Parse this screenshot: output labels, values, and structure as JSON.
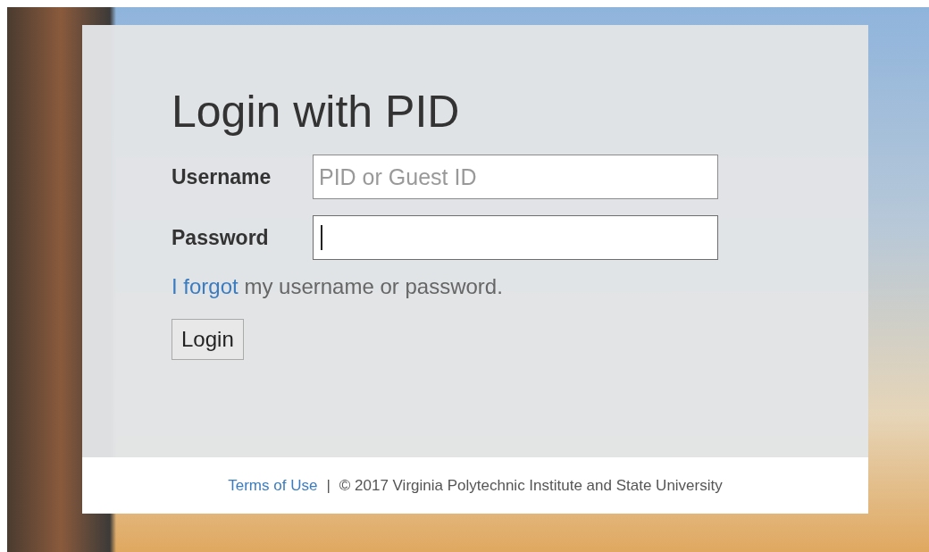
{
  "login_panel": {
    "title": "Login with PID",
    "fields": [
      {
        "label": "Username",
        "placeholder": "PID or Guest ID",
        "focused": false
      },
      {
        "label": "Password",
        "focused": true
      }
    ],
    "forgot": {
      "link": "I forgot",
      "text": " my username or password."
    },
    "button": "Login"
  },
  "footer": {
    "link": "Terms of Use",
    "separator": "|",
    "copyright": "© 2017 Virginia Polytechnic Institute and State University"
  }
}
